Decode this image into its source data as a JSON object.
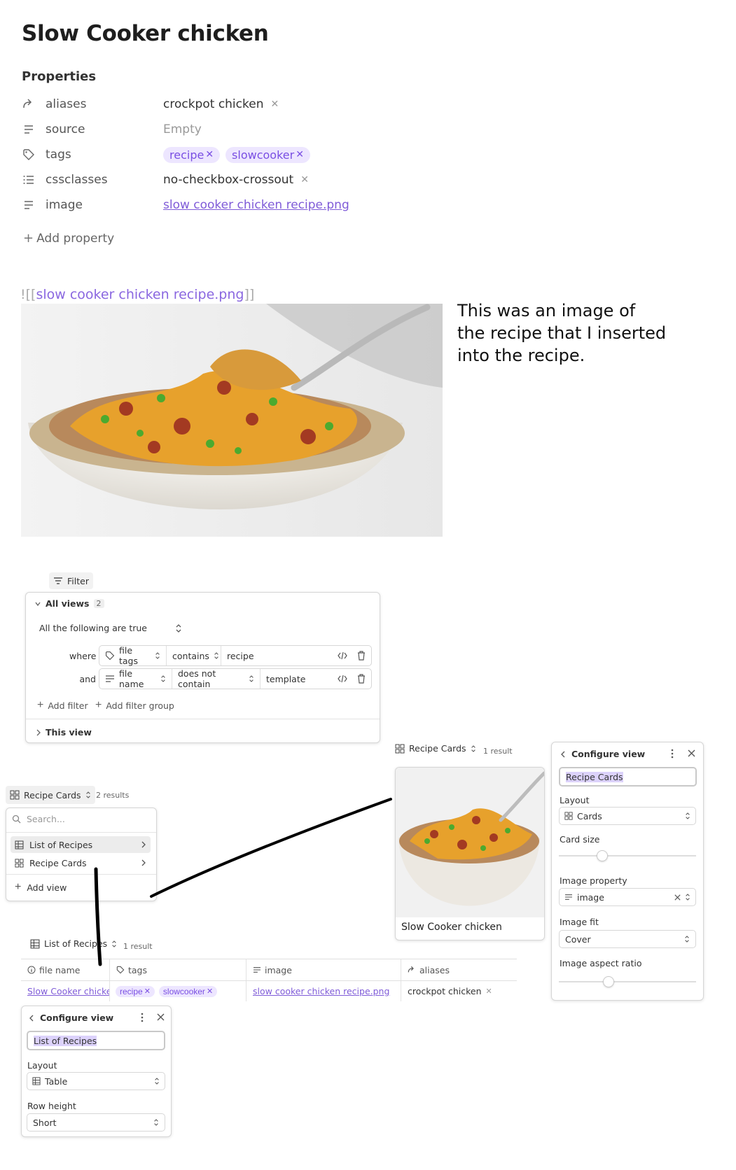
{
  "note": {
    "title": "Slow Cooker chicken",
    "properties_heading": "Properties",
    "properties": [
      {
        "icon": "alias-icon",
        "key": "aliases",
        "values": [
          "crockpot chicken"
        ],
        "style": "plain-x"
      },
      {
        "icon": "text-icon",
        "key": "source",
        "values": [
          "Empty"
        ],
        "style": "empty"
      },
      {
        "icon": "tag-icon",
        "key": "tags",
        "values": [
          "recipe",
          "slowcooker"
        ],
        "style": "pill"
      },
      {
        "icon": "list-icon",
        "key": "cssclasses",
        "values": [
          "no-checkbox-crossout"
        ],
        "style": "plain-x"
      },
      {
        "icon": "text-icon",
        "key": "image",
        "values": [
          "slow cooker chicken recipe.png"
        ],
        "style": "link"
      }
    ],
    "add_property": "Add property",
    "embed_prefix": "![[",
    "embed_target": "slow cooker chicken recipe.png",
    "embed_suffix": "]]",
    "annotation": "This was an image of the recipe that I inserted into the recipe."
  },
  "filter_panel": {
    "button_label": "Filter",
    "all_views_label": "All views",
    "all_views_count": "2",
    "condition": "All the following are true",
    "rules": [
      {
        "prefix": "where",
        "icon": "tag-icon",
        "field": "file tags",
        "operator": "contains",
        "value": "recipe"
      },
      {
        "prefix": "and",
        "icon": "text-icon",
        "field": "file name",
        "operator": "does not contain",
        "value": "template"
      }
    ],
    "add_filter": "Add filter",
    "add_filter_group": "Add filter group",
    "this_view": "This view"
  },
  "view_switcher": {
    "current": "Recipe Cards",
    "count": "2 results",
    "search_placeholder": "Search...",
    "items": [
      "List of Recipes",
      "Recipe Cards"
    ],
    "add_view": "Add view"
  },
  "cards_view": {
    "name": "Recipe Cards",
    "count": "1 result",
    "card_title": "Slow Cooker chicken"
  },
  "configure_cards": {
    "title": "Configure view",
    "name_value": "Recipe Cards",
    "layout_label": "Layout",
    "layout_value": "Cards",
    "card_size_label": "Card size",
    "card_size_level": 0.3,
    "image_property_label": "Image property",
    "image_property_value": "image",
    "image_fit_label": "Image fit",
    "image_fit_value": "Cover",
    "aspect_label": "Image aspect ratio",
    "aspect_level": 0.35
  },
  "table_view": {
    "name": "List of Recipes",
    "count": "1 result",
    "columns": [
      {
        "icon": "info-icon",
        "label": "file name"
      },
      {
        "icon": "tag-icon",
        "label": "tags"
      },
      {
        "icon": "text-icon",
        "label": "image"
      },
      {
        "icon": "alias-icon",
        "label": "aliases"
      }
    ],
    "row": {
      "file_name": "Slow Cooker chicken",
      "tags": [
        "recipe",
        "slowcooker"
      ],
      "image": "slow cooker chicken recipe.png",
      "aliases": "crockpot chicken"
    }
  },
  "configure_table": {
    "title": "Configure view",
    "name_value": "List of Recipes",
    "layout_label": "Layout",
    "layout_value": "Table",
    "row_height_label": "Row height",
    "row_height_value": "Short"
  },
  "colors": {
    "accent": "#7a4fe3",
    "pill_bg": "#ede6ff",
    "link": "#7f5bd8"
  }
}
